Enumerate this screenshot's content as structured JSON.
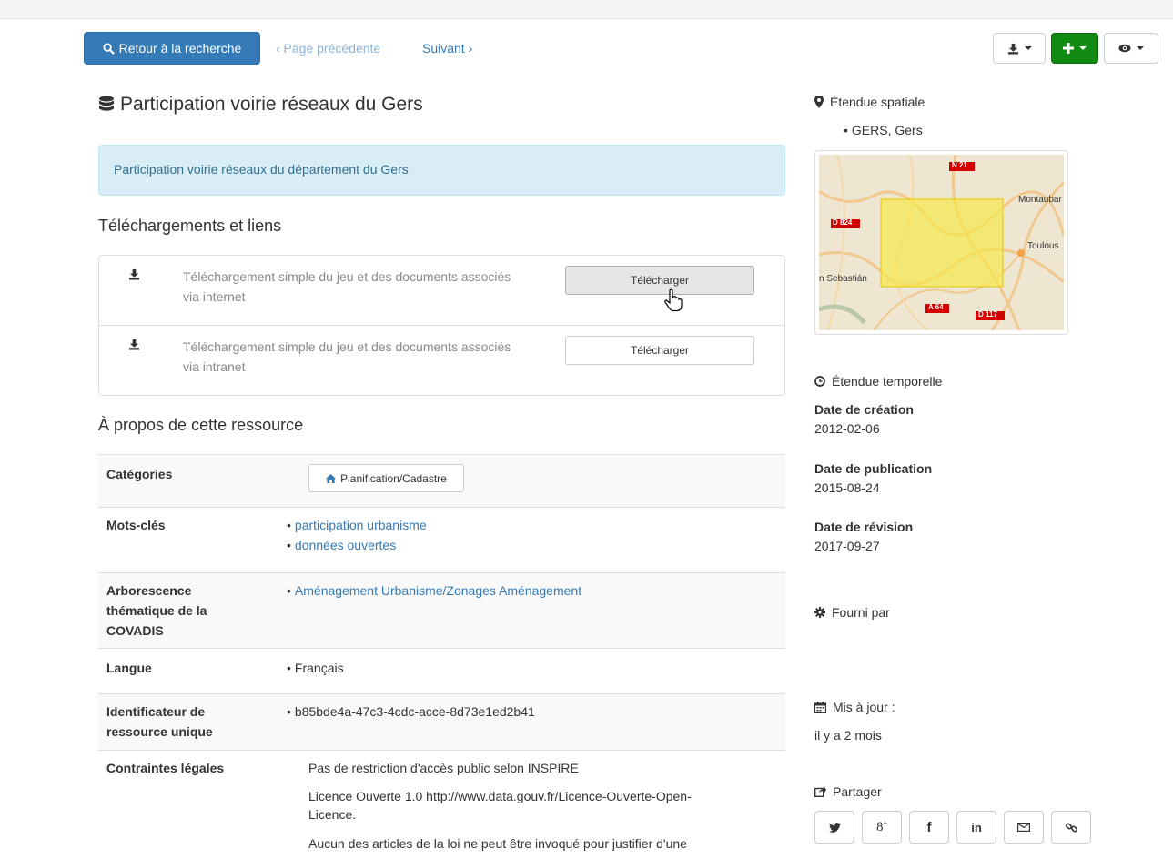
{
  "nav": {
    "back_label": "Retour à la recherche",
    "prev_label": "‹ Page précédente",
    "next_label": "Suivant ›"
  },
  "dataset": {
    "title": "Participation voirie réseaux du Gers",
    "description": "Participation voirie réseaux du département du Gers"
  },
  "downloads": {
    "heading": "Téléchargements et liens",
    "items": [
      {
        "text": "Téléchargement simple du jeu et des documents associés via internet",
        "button": "Télécharger"
      },
      {
        "text": "Téléchargement simple du jeu et des documents associés via intranet",
        "button": "Télécharger"
      }
    ]
  },
  "about": {
    "heading": "À propos de cette ressource",
    "categories_label": "Catégories",
    "category_value": "Planification/Cadastre",
    "keywords_label": "Mots-clés",
    "keywords": [
      "participation urbanisme",
      "données ouvertes"
    ],
    "covadis_label": "Arborescence thématique de la COVADIS",
    "covadis_value": "Aménagement Urbanisme/Zonages Aménagement",
    "language_label": "Langue",
    "language_value": "Français",
    "uid_label": "Identificateur de ressource unique",
    "uid_value": "b85bde4a-47c3-4cdc-acce-8d73e1ed2b41",
    "legal_label": "Contraintes légales",
    "legal_values": [
      "Pas de restriction d'accès public selon INSPIRE",
      "Licence Ouverte 1.0 http://www.data.gouv.fr/Licence-Ouverte-Open-Licence.",
      "Aucun des articles de la loi ne peut être invoqué pour justifier d'une"
    ]
  },
  "sidebar": {
    "spatial_heading": "Étendue spatiale",
    "spatial_value": "GERS, Gers",
    "map_labels": {
      "n21": "N 21",
      "d824": "D 824",
      "a64": "A 64",
      "d117": "D 117",
      "montauban": "Montaubar",
      "toulouse": "Toulous",
      "sebastian": "n Sebastián"
    },
    "temporal_heading": "Étendue temporelle",
    "creation_label": "Date de création",
    "creation_value": "2012-02-06",
    "publication_label": "Date de publication",
    "publication_value": "2015-08-24",
    "revision_label": "Date de révision",
    "revision_value": "2017-09-27",
    "provided_heading": "Fourni par",
    "updated_heading": "Mis à jour :",
    "updated_value": "il y a 2 mois",
    "share_heading": "Partager"
  },
  "colors": {
    "primary": "#337ab7",
    "success": "#108a10",
    "info_bg": "#d9edf7",
    "info_text": "#31708f",
    "link": "#337ab7"
  }
}
